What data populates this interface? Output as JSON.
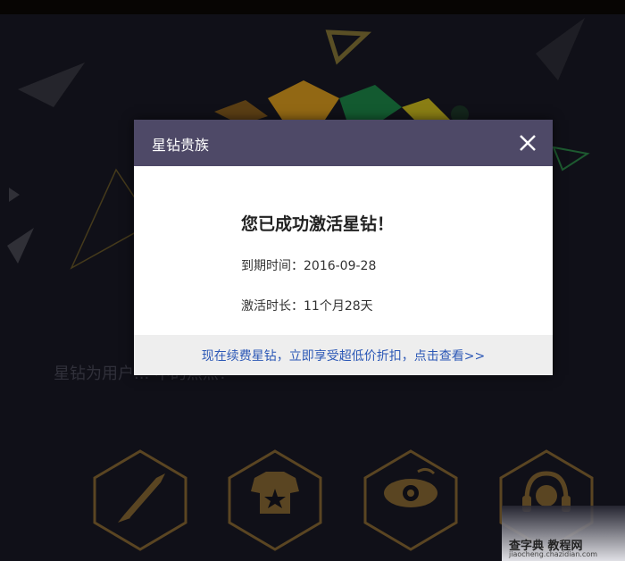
{
  "dialog": {
    "title": "星钻贵族",
    "headline": "您已成功激活星钻！",
    "expiry_label": "到期时间：",
    "expiry_value": "2016-09-28",
    "duration_label": "激活时长：",
    "duration_value": "11个月28天",
    "renew_link": "现在续费星钻，立即享受超低价折扣，点击查看>>"
  },
  "background": {
    "tagline": "星钻为用户... 中的焦点！",
    "features": [
      {
        "icon": "rocket-icon",
        "label": ""
      },
      {
        "icon": "tshirt-star-icon",
        "label": ""
      },
      {
        "icon": "eye-icon",
        "label": ""
      },
      {
        "icon": "headset-icon",
        "label": ""
      }
    ]
  },
  "watermark": {
    "main": "查字典 教程网",
    "sub": "jiaocheng.chazidian.com"
  },
  "colors": {
    "header": "#4e4967",
    "link": "#2c58b6",
    "hex_gold": "#8a6a35"
  }
}
